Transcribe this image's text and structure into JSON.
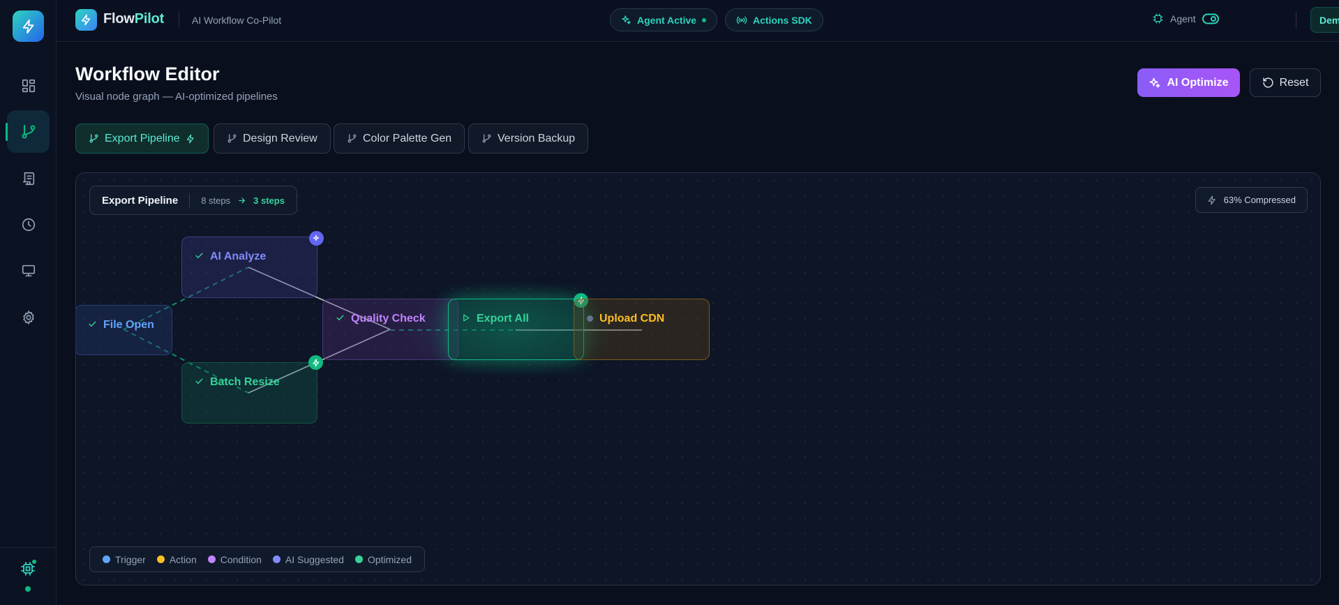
{
  "brand": {
    "name_a": "Flow",
    "name_b": "Pilot",
    "tagline": "AI Workflow Co-Pilot"
  },
  "header": {
    "status_pill": "Agent Active",
    "sdk_pill": "Actions SDK",
    "agent_label": "Agent",
    "demo_label": "Demo"
  },
  "page": {
    "title": "Workflow Editor",
    "subtitle": "Visual node graph — AI-optimized pipelines",
    "optimize_label": "AI Optimize",
    "reset_label": "Reset"
  },
  "tabs": [
    {
      "label": "Export Pipeline",
      "active": true
    },
    {
      "label": "Design Review"
    },
    {
      "label": "Color Palette Gen"
    },
    {
      "label": "Version Backup"
    }
  ],
  "canvas": {
    "workflow_name": "Export Pipeline",
    "steps_before": "8 steps",
    "steps_after": "3 steps",
    "compression": "63% Compressed"
  },
  "nodes": [
    {
      "label": "File Open",
      "kind": "trigger",
      "status": "done"
    },
    {
      "label": "AI Analyze",
      "kind": "ai-suggested",
      "status": "done"
    },
    {
      "label": "Batch Resize",
      "kind": "optimized",
      "status": "done"
    },
    {
      "label": "Quality Check",
      "kind": "condition",
      "status": "done"
    },
    {
      "label": "Export All",
      "kind": "optimized",
      "status": "running"
    },
    {
      "label": "Upload CDN",
      "kind": "action",
      "status": "pending"
    }
  ],
  "legend": [
    {
      "label": "Trigger",
      "color": "#60a5fa"
    },
    {
      "label": "Action",
      "color": "#fbbf24"
    },
    {
      "label": "Condition",
      "color": "#c084fc"
    },
    {
      "label": "AI Suggested",
      "color": "#818cf8"
    },
    {
      "label": "Optimized",
      "color": "#34d399"
    }
  ],
  "colors": {
    "accent_teal": "#2dd4bf",
    "accent_green": "#10b981",
    "accent_purple": "#a855f7",
    "background": "#0a0f1e"
  },
  "icons": {
    "logo": "bolt-icon",
    "sidebar": [
      "dashboard-icon",
      "branch-icon",
      "scroll-icon",
      "clock-icon",
      "monitor-icon",
      "gear-icon"
    ],
    "footer": "chip-icon"
  }
}
